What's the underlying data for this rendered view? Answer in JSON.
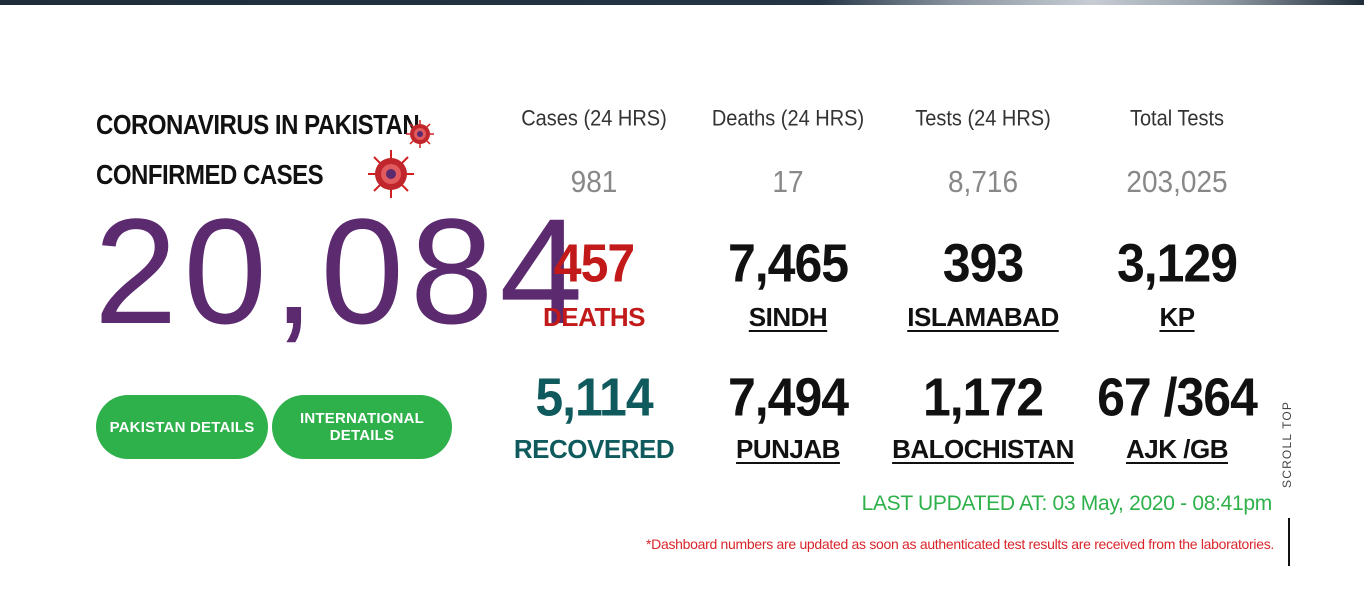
{
  "header": {
    "line1": "CORONAVIRUS IN PAKISTAN",
    "line2": "CONFIRMED CASES",
    "confirmed": "20,084",
    "icon": "coronavirus-icon"
  },
  "buttons": {
    "pakistan": "PAKISTAN DETAILS",
    "international": "INTERNATIONAL DETAILS"
  },
  "columns": [
    {
      "head": "Cases (24 HRS)",
      "value": "981"
    },
    {
      "head": "Deaths (24 HRS)",
      "value": "17"
    },
    {
      "head": "Tests (24 HRS)",
      "value": "8,716"
    },
    {
      "head": "Total Tests",
      "value": "203,025"
    }
  ],
  "stats": {
    "deaths": {
      "value": "457",
      "label": "DEATHS"
    },
    "recovered": {
      "value": "5,114",
      "label": "RECOVERED"
    }
  },
  "regions": {
    "sindh": {
      "value": "7,465",
      "label": "SINDH"
    },
    "islamabad": {
      "value": "393",
      "label": "ISLAMABAD"
    },
    "kp": {
      "value": "3,129",
      "label": "KP"
    },
    "punjab": {
      "value": "7,494",
      "label": "PUNJAB"
    },
    "balochistan": {
      "value": "1,172",
      "label": "BALOCHISTAN"
    },
    "ajk_gb": {
      "value": "67 /364",
      "label": "AJK /GB"
    }
  },
  "footer": {
    "updated": "LAST UPDATED AT: 03 May, 2020 - 08:41pm",
    "note": "*Dashboard numbers are updated as soon as authenticated test results are received from the laboratories.",
    "scroll_top": "SCROLL TOP"
  },
  "colors": {
    "purple": "#5b2a6f",
    "green": "#2eb14a",
    "red": "#c21a1a",
    "teal": "#0f5a5c"
  }
}
